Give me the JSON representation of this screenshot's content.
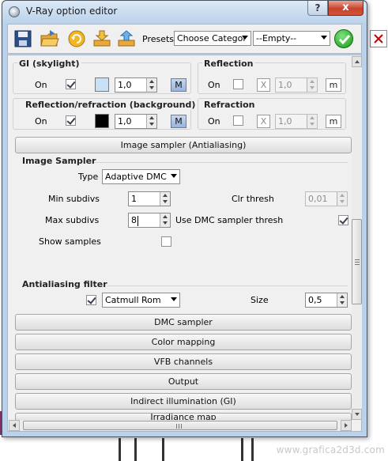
{
  "window": {
    "title": "V-Ray option editor",
    "help_label": "?",
    "close_label": "x"
  },
  "toolbar": {
    "icons": [
      "save-icon",
      "open-folder-icon",
      "reload-icon",
      "import-icon",
      "export-icon"
    ],
    "presets_label": "Presets:",
    "presets_combo": "Choose Categor",
    "second_combo": "--Empty--",
    "apply_icon": "checkmark-icon"
  },
  "gi_skylight": {
    "title": "GI (skylight)",
    "on_label": "On",
    "on_checked": true,
    "color": "#c9e1f7",
    "multiplier": "1,0",
    "map_button": "M"
  },
  "reflection": {
    "title": "Reflection",
    "on_label": "On",
    "on_checked": false,
    "color_button": "X",
    "multiplier": "1,0",
    "map_button": "m"
  },
  "reflection_refraction_bg": {
    "title": "Reflection/refraction (background)",
    "on_label": "On",
    "on_checked": true,
    "color": "#000000",
    "multiplier": "1,0",
    "map_button": "M"
  },
  "refraction": {
    "title": "Refraction",
    "on_label": "On",
    "on_checked": false,
    "color_button": "X",
    "multiplier": "1,0",
    "map_button": "m"
  },
  "image_sampler_rollout": "Image sampler (Antialiasing)",
  "image_sampler": {
    "title": "Image Sampler",
    "type_label": "Type",
    "type_value": "Adaptive DMC",
    "min_subdivs_label": "Min subdivs",
    "min_subdivs": "1",
    "clr_thresh_label": "Clr thresh",
    "clr_thresh": "0,01",
    "max_subdivs_label": "Max subdivs",
    "max_subdivs": "8",
    "use_dmc_label": "Use DMC sampler thresh",
    "use_dmc_checked": true,
    "show_samples_label": "Show samples",
    "show_samples_checked": false
  },
  "aa_filter": {
    "title": "Antialiasing filter",
    "enabled": true,
    "filter_value": "Catmull Rom",
    "size_label": "Size",
    "size_value": "0,5"
  },
  "rollouts": [
    "DMC sampler",
    "Color mapping",
    "VFB channels",
    "Output",
    "Indirect illumination (GI)",
    "Irradiance map"
  ],
  "background": {
    "watermark": "www.grafica2d3d.com"
  }
}
